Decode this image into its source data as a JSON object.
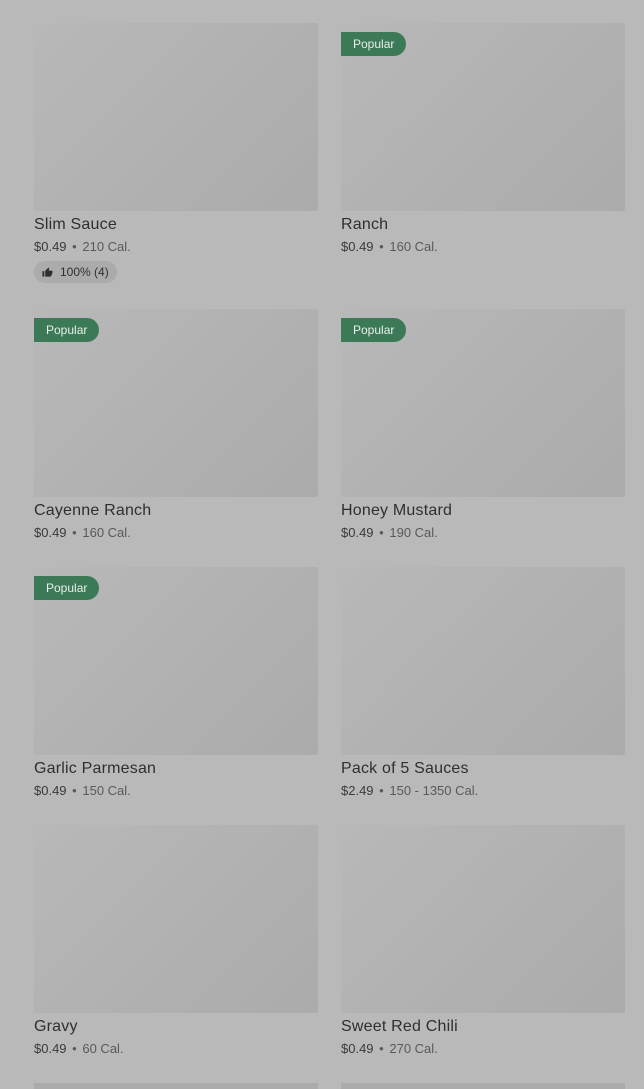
{
  "items": [
    {
      "name": "Slim Sauce",
      "price": "$0.49",
      "cal": "210 Cal.",
      "badge": "",
      "rating": "100% (4)"
    },
    {
      "name": "Ranch",
      "price": "$0.49",
      "cal": "160 Cal.",
      "badge": "Popular"
    },
    {
      "name": "Cayenne Ranch",
      "price": "$0.49",
      "cal": "160 Cal.",
      "badge": "Popular"
    },
    {
      "name": "Honey Mustard",
      "price": "$0.49",
      "cal": "190 Cal.",
      "badge": "Popular"
    },
    {
      "name": "Garlic Parmesan",
      "price": "$0.49",
      "cal": "150 Cal.",
      "badge": "Popular"
    },
    {
      "name": "Pack of 5 Sauces",
      "price": "$2.49",
      "cal": "150 - 1350 Cal.",
      "badge": ""
    },
    {
      "name": "Gravy",
      "price": "$0.49",
      "cal": "60 Cal.",
      "badge": ""
    },
    {
      "name": "Sweet Red Chili",
      "price": "$0.49",
      "cal": "270 Cal.",
      "badge": ""
    }
  ],
  "separator": "•",
  "icons": {
    "rating": "thumbs-up-icon"
  },
  "colors": {
    "badge_bg": "#3c7a57",
    "overlay_bg": "#b9b9b9"
  }
}
